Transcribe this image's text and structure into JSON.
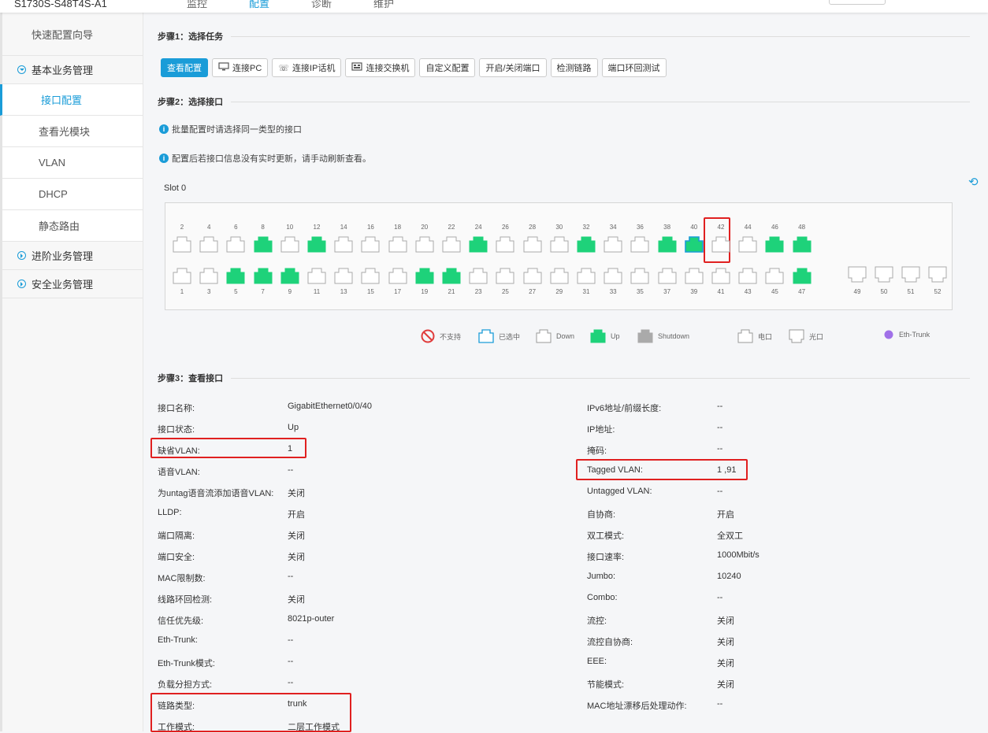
{
  "header": {
    "device_name": "S1730S-S48T4S-A1",
    "nav": [
      "监控",
      "配置",
      "诊断",
      "维护"
    ],
    "active_nav": 1
  },
  "sidebar": {
    "quick": "快速配置向导",
    "groups": [
      {
        "label": "基本业务管理",
        "expanded": true,
        "items": [
          "接口配置",
          "查看光模块",
          "VLAN",
          "DHCP",
          "静态路由"
        ]
      },
      {
        "label": "进阶业务管理",
        "expanded": false
      },
      {
        "label": "安全业务管理",
        "expanded": false
      }
    ],
    "active_item": "接口配置"
  },
  "step1": {
    "title": "步骤1：选择任务",
    "tasks": [
      {
        "label": "查看配置",
        "icon": "",
        "active": true
      },
      {
        "label": "连接PC",
        "icon": "pc-icon",
        "active": false
      },
      {
        "label": "连接IP话机",
        "icon": "phone-icon",
        "active": false
      },
      {
        "label": "连接交换机",
        "icon": "switch-icon",
        "active": false
      },
      {
        "label": "自定义配置",
        "icon": "",
        "active": false
      },
      {
        "label": "开启/关闭端口",
        "icon": "",
        "active": false
      },
      {
        "label": "检测链路",
        "icon": "",
        "active": false
      },
      {
        "label": "端口环回测试",
        "icon": "",
        "active": false
      }
    ]
  },
  "step2": {
    "title": "步骤2：选择接口",
    "tips": [
      "批量配置时请选择同一类型的接口",
      "配置后若接口信息没有实时更新，请手动刷新查看。"
    ],
    "slot_label": "Slot 0",
    "top_ports": [
      "2",
      "4",
      "6",
      "8",
      "10",
      "12",
      "14",
      "16",
      "18",
      "20",
      "22",
      "24",
      "26",
      "28",
      "30",
      "32",
      "34",
      "36",
      "38",
      "40",
      "42",
      "44",
      "46",
      "48"
    ],
    "bottom_ports": [
      "1",
      "3",
      "5",
      "7",
      "9",
      "11",
      "13",
      "15",
      "17",
      "19",
      "21",
      "23",
      "25",
      "27",
      "29",
      "31",
      "33",
      "35",
      "37",
      "39",
      "41",
      "43",
      "45",
      "47"
    ],
    "up_ports": [
      "8",
      "12",
      "24",
      "32",
      "38",
      "40",
      "46",
      "48",
      "5",
      "7",
      "9",
      "19",
      "21",
      "47"
    ],
    "selected_port": "40",
    "sfp_ports": [
      "49",
      "50",
      "51",
      "52"
    ],
    "legend": [
      "不支持",
      "已选中",
      "Down",
      "Up",
      "Shutdown",
      "电口",
      "光口",
      "Eth-Trunk"
    ],
    "colors": {
      "up": "#1ed27a",
      "selected": "#1a9cd8",
      "shutdown": "#aaaaaa",
      "trunk": "#a070e8",
      "unsupported": "#e03c3c"
    }
  },
  "step3": {
    "title": "步骤3：查看接口",
    "left": [
      {
        "label": "接口名称:",
        "value": "GigabitEthernet0/0/40"
      },
      {
        "label": "接口状态:",
        "value": "Up"
      },
      {
        "label": "缺省VLAN:",
        "value": "1"
      },
      {
        "label": "语音VLAN:",
        "value": "--"
      },
      {
        "label": "为untag语音流添加语音VLAN:",
        "value": "关闭"
      },
      {
        "label": "LLDP:",
        "value": "开启"
      },
      {
        "label": "端口隔离:",
        "value": "关闭"
      },
      {
        "label": "端口安全:",
        "value": "关闭"
      },
      {
        "label": "MAC限制数:",
        "value": "--"
      },
      {
        "label": "线路环回检测:",
        "value": "关闭"
      },
      {
        "label": "信任优先级:",
        "value": "8021p-outer"
      },
      {
        "label": "Eth-Trunk:",
        "value": "--"
      },
      {
        "label": "Eth-Trunk模式:",
        "value": "--"
      },
      {
        "label": "负载分担方式:",
        "value": "--"
      },
      {
        "label": "链路类型:",
        "value": "trunk"
      },
      {
        "label": "工作模式:",
        "value": "二层工作模式"
      }
    ],
    "right": [
      {
        "label": "IPv6地址/前缀长度:",
        "value": "--"
      },
      {
        "label": "IP地址:",
        "value": "--"
      },
      {
        "label": "掩码:",
        "value": "--"
      },
      {
        "label": "Tagged VLAN:",
        "value": "1 ,91"
      },
      {
        "label": "Untagged VLAN:",
        "value": "--"
      },
      {
        "label": "自协商:",
        "value": "开启"
      },
      {
        "label": "双工模式:",
        "value": "全双工"
      },
      {
        "label": "接口速率:",
        "value": "1000Mbit/s"
      },
      {
        "label": "Jumbo:",
        "value": "10240"
      },
      {
        "label": "Combo:",
        "value": "--"
      },
      {
        "label": "流控:",
        "value": "关闭"
      },
      {
        "label": "流控自协商:",
        "value": "关闭"
      },
      {
        "label": "EEE:",
        "value": "关闭"
      },
      {
        "label": "节能模式:",
        "value": "关闭"
      },
      {
        "label": "MAC地址漂移后处理动作:",
        "value": "--"
      }
    ]
  }
}
